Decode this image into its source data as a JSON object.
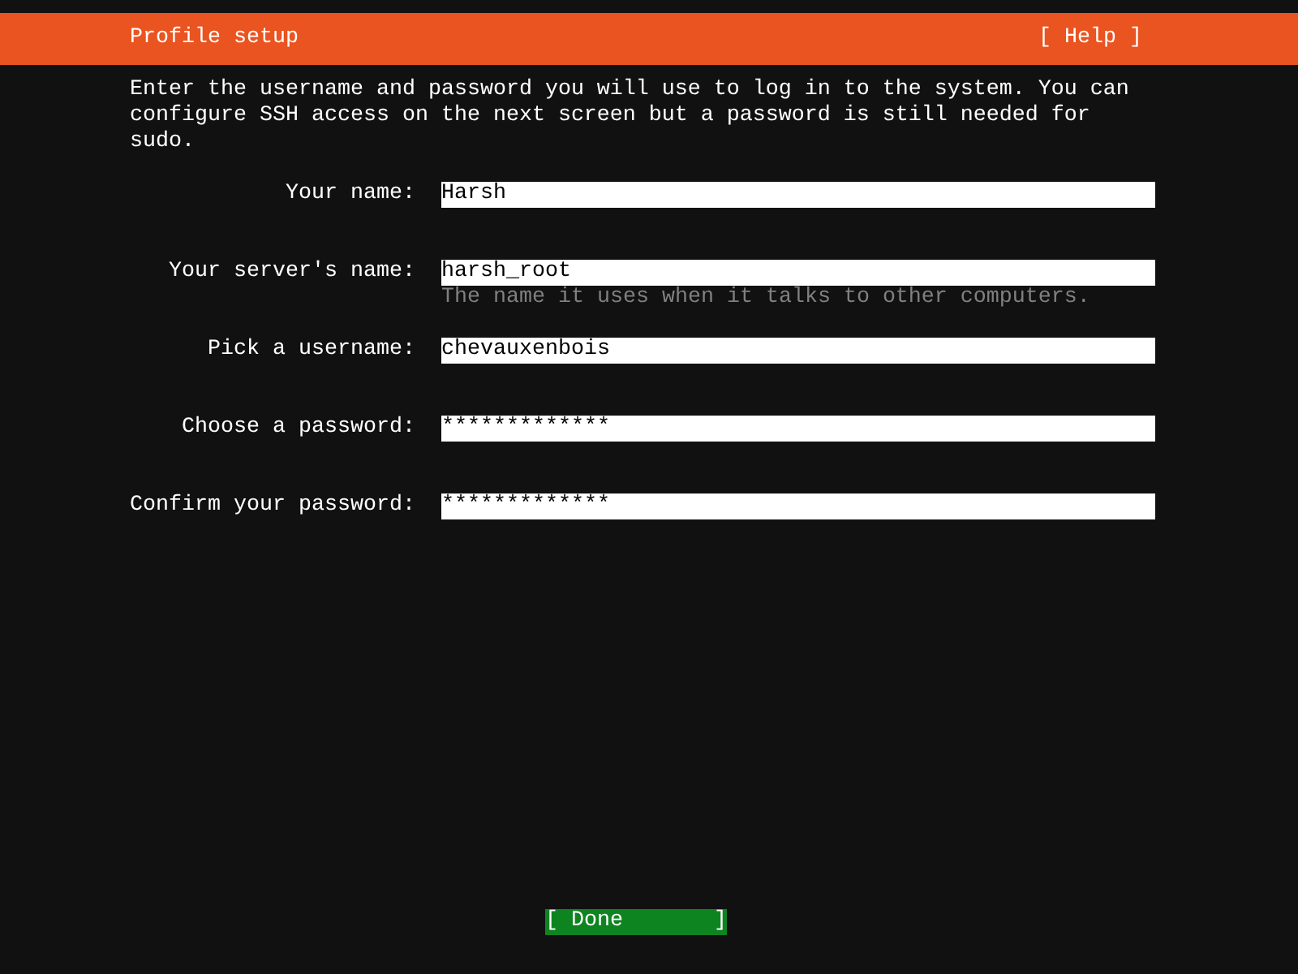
{
  "header": {
    "title": "Profile setup",
    "help_button": "[ Help ]"
  },
  "intro": "Enter the username and password you will use to log in to the system. You can configure SSH access on the next screen but a password is still needed for sudo.",
  "fields": [
    {
      "label": "Your name:",
      "value": "Harsh"
    },
    {
      "label": "Your server's name:",
      "value": "harsh_root",
      "hint": "The name it uses when it talks to other computers."
    },
    {
      "label": "Pick a username:",
      "value": "chevauxenbois"
    },
    {
      "label": "Choose a password:",
      "value": "*************"
    },
    {
      "label": "Confirm your password:",
      "value": "*************"
    }
  ],
  "done_button": "[ Done       ]"
}
